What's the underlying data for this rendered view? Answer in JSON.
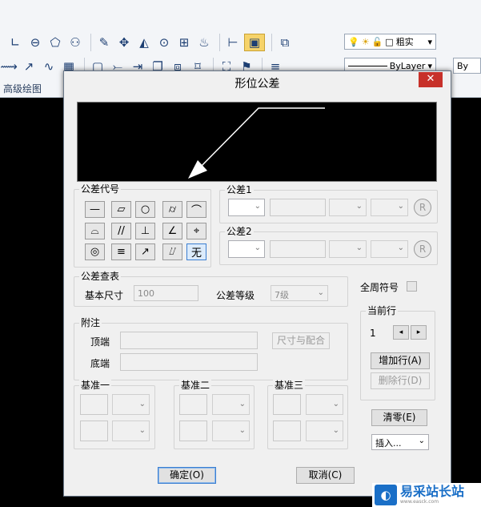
{
  "ribbon": {
    "panel_label": "高级绘图",
    "layer_combo_text": "粗实",
    "linetype_combo_text": "ByLayer",
    "lineweight_combo_text": "By",
    "icons_row1": [
      "linear-dimension-icon",
      "ellipse-icon",
      "polygon-icon",
      "user-icon",
      "paint-icon",
      "move-icon",
      "mirror-icon",
      "rotate-icon",
      "array-icon",
      "hatch-icon",
      "dimension-icon",
      "block-icon",
      "layer-icon",
      "bulb-icon"
    ],
    "icons_row2": [
      "polyline-icon",
      "arrow-icon",
      "spline-icon",
      "table-icon",
      "rectangle-icon",
      "trim-icon",
      "extend-icon",
      "copy-icon",
      "offset-icon",
      "measure-icon",
      "properties-icon",
      "lineweight-icon"
    ]
  },
  "dialog": {
    "title": "形位公差",
    "close_label": "✕",
    "symbol_group_label": "公差代号",
    "symbols": [
      "—",
      "▱",
      "○",
      "⌭",
      "⌒",
      "⌓",
      "//",
      "⊥",
      "∠",
      "⌖",
      "◎",
      "≡",
      "↗",
      "⌰",
      "无"
    ],
    "tol1_label": "公差1",
    "tol2_label": "公差2",
    "lookup_group_label": "公差查表",
    "basic_size_label": "基本尺寸",
    "basic_size_value": "100",
    "grade_label": "公差等级",
    "grade_value": "7级",
    "note_group_label": "附注",
    "top_label": "顶端",
    "bottom_label": "底端",
    "fit_button": "尺寸与配合",
    "datum1_label": "基准一",
    "datum2_label": "基准二",
    "datum3_label": "基准三",
    "all_around_label": "全周符号",
    "current_row_label": "当前行",
    "current_row_value": "1",
    "add_row_button": "增加行(A)",
    "delete_row_button": "删除行(D)",
    "clear_button": "清零(E)",
    "insert_combo": "插入...",
    "ok_button": "确定(O)",
    "cancel_button": "取消(C)",
    "r_symbol": "R"
  },
  "watermark": {
    "logo_glyph": "◐",
    "text": "易采站长站",
    "subtext": "www.easck.com"
  }
}
